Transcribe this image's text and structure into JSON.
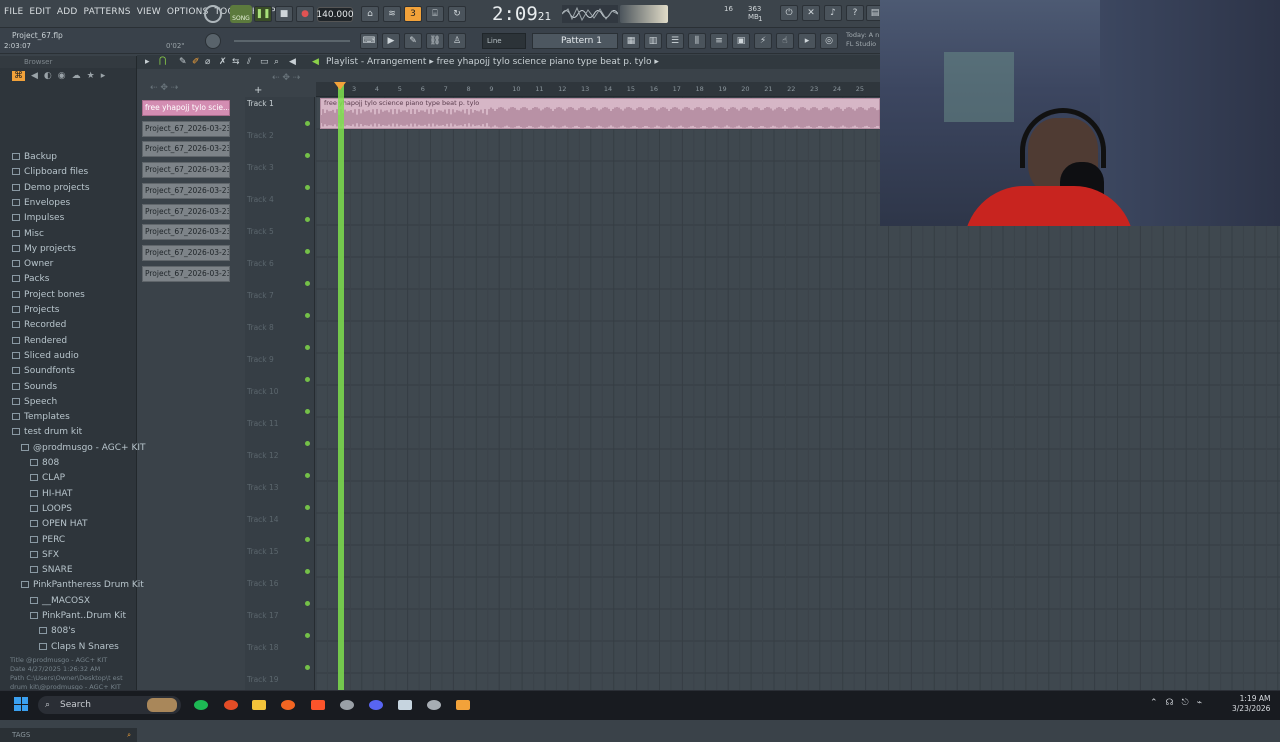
{
  "menu": [
    "FILE",
    "EDIT",
    "ADD",
    "PATTERNS",
    "VIEW",
    "OPTIONS",
    "TOOLS",
    "HELP"
  ],
  "transport": {
    "song_label": "SONG",
    "bpm": "140.000",
    "clock": "2:09",
    "clock_frac": "21",
    "pattern": "Pattern 1",
    "snap": "Line",
    "mem": "363 MB",
    "cpu": "16",
    "voices": "1",
    "today_hint": "Today: A n",
    "fl_studio": "FL Studio"
  },
  "project": {
    "file": "Project_67.flp",
    "time": "2:03:07",
    "pos": "0'02\""
  },
  "browser": {
    "title": "Browser",
    "items": [
      {
        "label": "Backup",
        "depth": 0
      },
      {
        "label": "Clipboard files",
        "depth": 0
      },
      {
        "label": "Demo projects",
        "depth": 0
      },
      {
        "label": "Envelopes",
        "depth": 0
      },
      {
        "label": "Impulses",
        "depth": 0
      },
      {
        "label": "Misc",
        "depth": 0
      },
      {
        "label": "My projects",
        "depth": 0
      },
      {
        "label": "Owner",
        "depth": 0
      },
      {
        "label": "Packs",
        "depth": 0
      },
      {
        "label": "Project bones",
        "depth": 0
      },
      {
        "label": "Projects",
        "depth": 0
      },
      {
        "label": "Recorded",
        "depth": 0
      },
      {
        "label": "Rendered",
        "depth": 0
      },
      {
        "label": "Sliced audio",
        "depth": 0
      },
      {
        "label": "Soundfonts",
        "depth": 0
      },
      {
        "label": "Sounds",
        "depth": 0
      },
      {
        "label": "Speech",
        "depth": 0
      },
      {
        "label": "Templates",
        "depth": 0
      },
      {
        "label": "test drum kit",
        "depth": 0
      },
      {
        "label": "@prodmusgo - AGC+ KIT",
        "depth": 1
      },
      {
        "label": "808",
        "depth": 2
      },
      {
        "label": "CLAP",
        "depth": 2
      },
      {
        "label": "HI-HAT",
        "depth": 2
      },
      {
        "label": "LOOPS",
        "depth": 2
      },
      {
        "label": "OPEN HAT",
        "depth": 2
      },
      {
        "label": "PERC",
        "depth": 2
      },
      {
        "label": "SFX",
        "depth": 2
      },
      {
        "label": "SNARE",
        "depth": 2
      },
      {
        "label": "PinkPantheress Drum Kit",
        "depth": 1
      },
      {
        "label": "__MACOSX",
        "depth": 2
      },
      {
        "label": "PinkPant..Drum Kit",
        "depth": 2
      },
      {
        "label": "808's",
        "depth": 3
      },
      {
        "label": "Claps N Snares",
        "depth": 3
      }
    ],
    "info": {
      "title": "Title  @prodmusgo - AGC+ KIT",
      "date": "Date  4/27/2025 1:26:32 AM",
      "path": "Path  C:\\Users\\Owner\\Desktop\\t est drum kit\\@prodmusgo - AGC+ KIT"
    },
    "tags_label": "TAGS"
  },
  "patterns": [
    "free yhapojj tylo scie...",
    "Project_67_2026-03-23...",
    "Project_67_2026-03-23...",
    "Project_67_2026-03-23...",
    "Project_67_2026-03-23...",
    "Project_67_2026-03-23...",
    "Project_67_2026-03-23...",
    "Project_67_2026-03-23...",
    "Project_67_2026-03-23..."
  ],
  "playlist": {
    "title": "Playlist - Arrangement",
    "breadcrumb": "free yhapojj tylo science piano type beat p. tylo",
    "clip_label": "free yhapojj tylo science piano type beat p. tylo",
    "ruler": [
      "3",
      "4",
      "5",
      "6",
      "7",
      "8",
      "9",
      "10",
      "11",
      "12",
      "13",
      "14",
      "15",
      "16",
      "17",
      "18",
      "19",
      "20",
      "21",
      "22",
      "23",
      "24",
      "25"
    ],
    "tracks": [
      "Track 1",
      "Track 2",
      "Track 3",
      "Track 4",
      "Track 5",
      "Track 6",
      "Track 7",
      "Track 8",
      "Track 9",
      "Track 10",
      "Track 11",
      "Track 12",
      "Track 13",
      "Track 14",
      "Track 15",
      "Track 16",
      "Track 17",
      "Track 18",
      "Track 19"
    ]
  },
  "taskbar": {
    "search": "Search",
    "time": "1:19 AM",
    "date": "3/23/2026"
  },
  "colors": {
    "clip": "#d6b6c6",
    "playhead": "#7ee04e",
    "accent_orange": "#f2a23a",
    "track_dot": "#74c048"
  }
}
